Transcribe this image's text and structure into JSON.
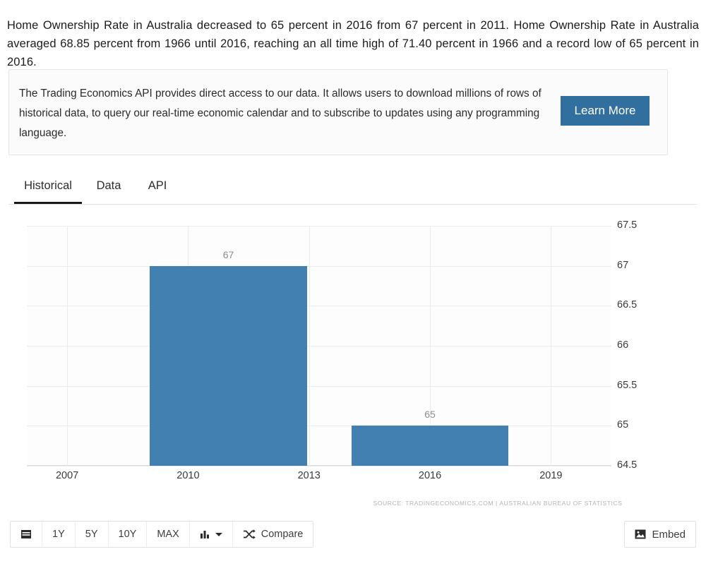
{
  "intro": {
    "paragraph": "Home Ownership Rate in Australia decreased to 65 percent in 2016 from 67 percent in 2011. Home Ownership Rate in Australia averaged 68.85 percent from 1966 until 2016, reaching an all time high of 71.40 percent in 1966 and a record low of 65 percent in 2016."
  },
  "promo": {
    "text": "The Trading Economics API provides direct access to our data. It allows users to download millions of rows of historical data, to query our real-time economic calendar and to subscribe to updates using any programming language.",
    "button_label": "Learn More",
    "button_color": "#31709e"
  },
  "tabs": [
    {
      "label": "Historical",
      "active": true
    },
    {
      "label": "Data",
      "active": false
    },
    {
      "label": "API",
      "active": false
    }
  ],
  "toolbar": {
    "calendar_icon": "calendar-icon",
    "ranges": [
      "1Y",
      "5Y",
      "10Y",
      "MAX"
    ],
    "chart_type_icon": "bar-chart-icon",
    "chart_type_caret": "chevron-down-icon",
    "compare_icon": "shuffle-icon",
    "compare_label": "Compare",
    "embed_icon": "image-icon",
    "embed_label": "Embed"
  },
  "chart_data": {
    "type": "bar",
    "title": "",
    "xlabel": "",
    "ylabel": "",
    "categories": [
      "2011",
      "2016"
    ],
    "values": [
      67,
      65
    ],
    "bar_labels": [
      "67",
      "65"
    ],
    "bar_color": "#4180b0",
    "x_positions": [
      2011,
      2016
    ],
    "xlim": [
      2006,
      2020.5
    ],
    "ylim": [
      64.5,
      67.5
    ],
    "yticks": [
      "67.5",
      "67",
      "66.5",
      "66",
      "65.5",
      "65",
      "64.5"
    ],
    "ytick_values": [
      67.5,
      67,
      66.5,
      66,
      65.5,
      65,
      64.5
    ],
    "xticks": [
      "2007",
      "2010",
      "2013",
      "2016",
      "2019"
    ],
    "xtick_values": [
      2007,
      2010,
      2013,
      2016,
      2019
    ],
    "grid": true,
    "legend": "none",
    "source": "SOURCE: TRADINGECONOMICS.COM | AUSTRALIAN BUREAU OF STATISTICS"
  }
}
